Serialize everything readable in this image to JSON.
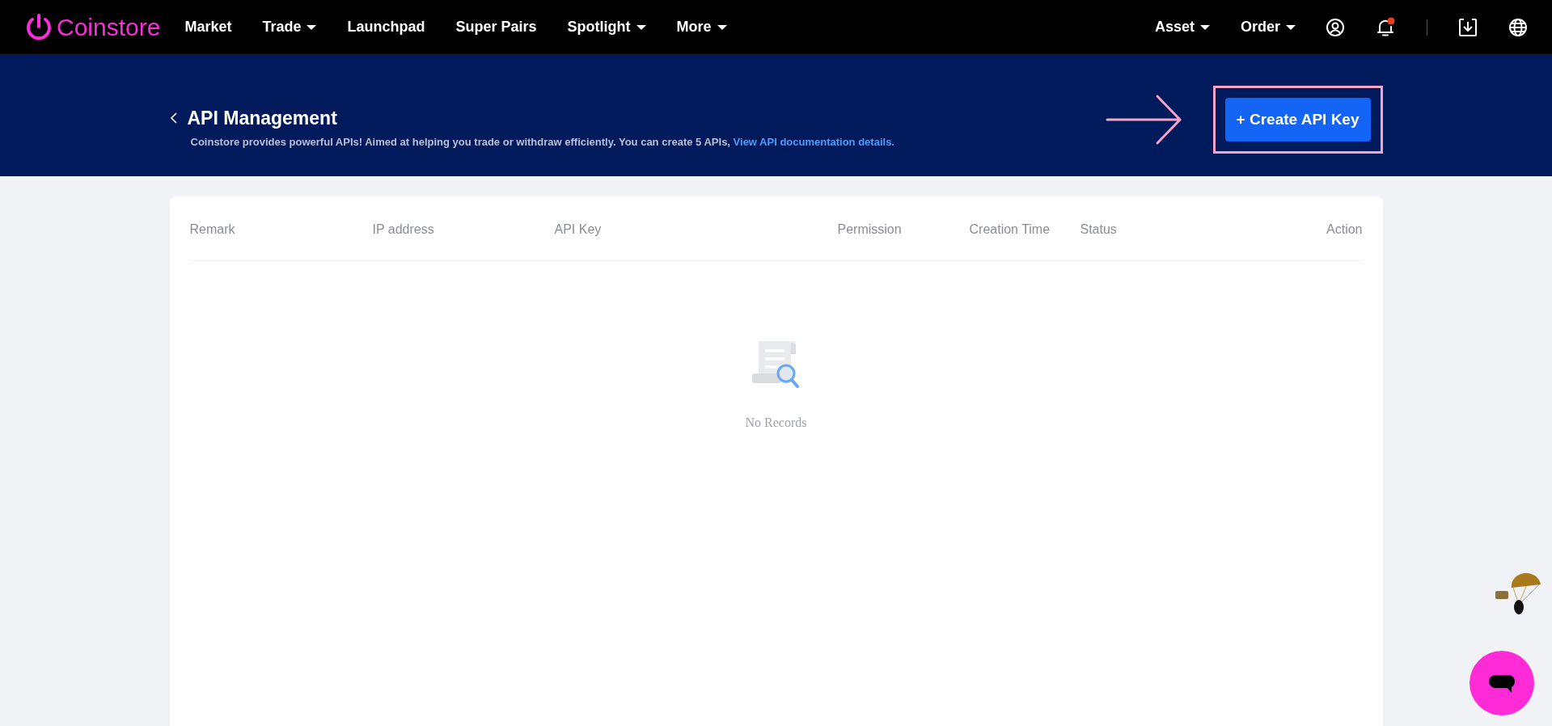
{
  "logo": {
    "text": "Coinstore"
  },
  "nav": [
    {
      "label": "Market",
      "kind": "link"
    },
    {
      "label": "Trade",
      "kind": "dropdown"
    },
    {
      "label": "Launchpad",
      "kind": "link"
    },
    {
      "label": "Super Pairs",
      "kind": "link"
    },
    {
      "label": "Spotlight",
      "kind": "dropdown"
    },
    {
      "label": "More",
      "kind": "dropdown"
    }
  ],
  "nav_right": [
    {
      "label": "Asset",
      "kind": "dropdown"
    },
    {
      "label": "Order",
      "kind": "dropdown"
    }
  ],
  "notifications": {
    "unread": true
  },
  "page": {
    "title": "API Management",
    "description": "Coinstore provides powerful APIs! Aimed at helping you trade or withdraw efficiently. You can create 5 APIs,",
    "link": "View API documentation details.",
    "button": "+ Create API Key"
  },
  "table": {
    "columns": [
      "Remark",
      "IP address",
      "API Key",
      "Permission",
      "Creation Time",
      "Status",
      "Action"
    ],
    "empty_text": "No Records"
  }
}
